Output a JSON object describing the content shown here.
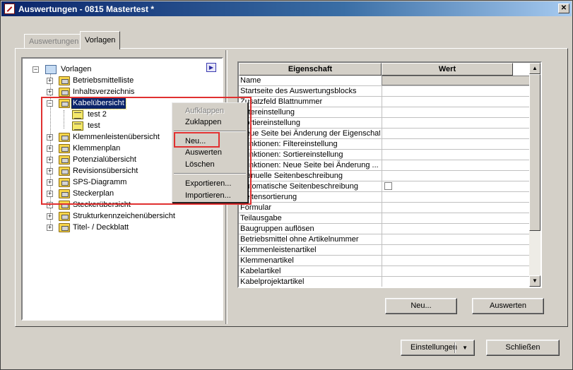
{
  "window": {
    "title": "Auswertungen - 0815 Mastertest *",
    "close_label": "✕"
  },
  "tabs": [
    {
      "label": "Auswertungen",
      "active": false
    },
    {
      "label": "Vorlagen",
      "active": true
    }
  ],
  "tree": {
    "root": "Vorlagen",
    "items": [
      {
        "label": "Betriebsmittelliste"
      },
      {
        "label": "Inhaltsverzeichnis"
      },
      {
        "label": "Kabelübersicht",
        "selected": true,
        "expanded": true,
        "children": [
          {
            "label": "test 2"
          },
          {
            "label": "test"
          }
        ]
      },
      {
        "label": "Klemmenleistenübersicht"
      },
      {
        "label": "Klemmenplan"
      },
      {
        "label": "Potenzialübersicht"
      },
      {
        "label": "Revisionsübersicht"
      },
      {
        "label": "SPS-Diagramm"
      },
      {
        "label": "Steckerplan"
      },
      {
        "label": "Steckerübersicht"
      },
      {
        "label": "Strukturkennzeichenübersicht"
      },
      {
        "label": "Titel- / Deckblatt"
      }
    ]
  },
  "context_menu": {
    "items": [
      {
        "label": "Aufklappen",
        "disabled": true
      },
      {
        "label": "Zuklappen"
      },
      {
        "label": "Neu..."
      },
      {
        "label": "Auswerten"
      },
      {
        "label": "Löschen"
      },
      {
        "label": "Exportieren..."
      },
      {
        "label": "Importieren..."
      }
    ]
  },
  "grid": {
    "headers": {
      "property": "Eigenschaft",
      "value": "Wert"
    },
    "rows": [
      {
        "property": "Name"
      },
      {
        "property": "Startseite des Auswertungsblocks"
      },
      {
        "property": "Zusatzfeld Blattnummer"
      },
      {
        "property": "Filtereinstellung"
      },
      {
        "property": "Sortiereinstellung"
      },
      {
        "property": "Neue Seite bei Änderung der Eigenschaft"
      },
      {
        "property": "Funktionen: Filtereinstellung"
      },
      {
        "property": "Funktionen: Sortiereinstellung"
      },
      {
        "property": "Funktionen: Neue Seite bei Änderung ..."
      },
      {
        "property": "Manuelle Seitenbeschreibung"
      },
      {
        "property": "Automatische Seitenbeschreibung",
        "checkbox": true
      },
      {
        "property": "Seitensortierung"
      },
      {
        "property": "Formular"
      },
      {
        "property": "Teilausgabe"
      },
      {
        "property": "Baugruppen auflösen"
      },
      {
        "property": "Betriebsmittel ohne Artikelnummer"
      },
      {
        "property": "Klemmenleistenartikel"
      },
      {
        "property": "Klemmenartikel"
      },
      {
        "property": "Kabelartikel"
      },
      {
        "property": "Kabelprojektartikel"
      }
    ]
  },
  "buttons": {
    "neu": "Neu...",
    "auswerten": "Auswerten",
    "einstellungen": "Einstellungen",
    "schliessen": "Schließen"
  },
  "colors": {
    "highlight": "#e03030",
    "selection": "#0a246a"
  }
}
